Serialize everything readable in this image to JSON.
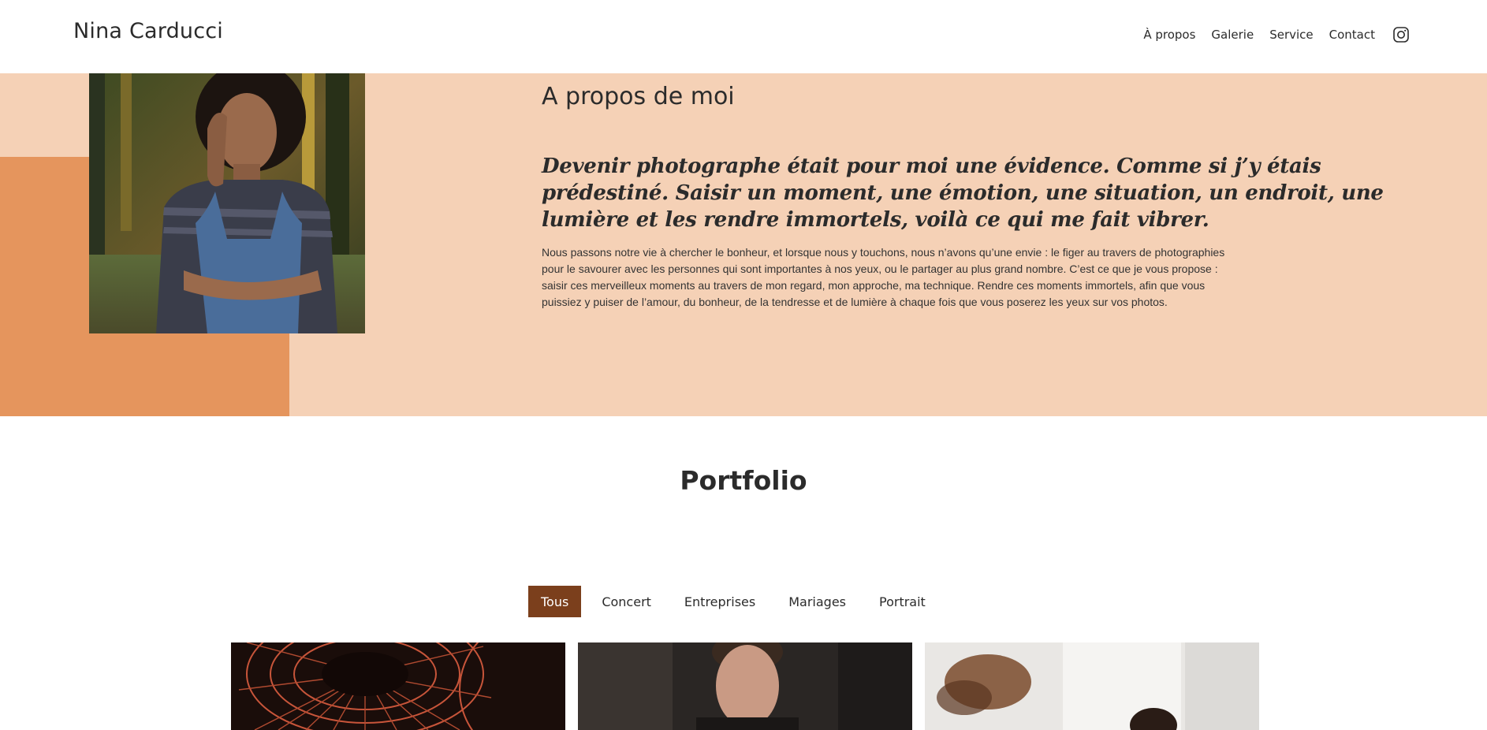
{
  "header": {
    "brand": "Nina Carducci",
    "nav": [
      "À propos",
      "Galerie",
      "Service",
      "Contact"
    ],
    "social_icon": "instagram-icon"
  },
  "about": {
    "title": "A propos de moi",
    "quote": "Devenir photographe était pour moi une évidence. Comme si j’y étais prédestiné. Saisir un moment, une émotion, une situation, un endroit, une lumière et les rendre immortels, voilà ce qui me fait vibrer.",
    "body": "Nous passons notre vie à chercher le bonheur, et lorsque nous y touchons, nous n’avons qu’une envie : le figer au travers de photographies pour le savourer avec les personnes qui sont importantes à nos yeux, ou le partager au plus grand nombre. C’est ce que je vous propose : saisir ces merveilleux moments au travers de mon regard, mon approche, ma technique. Rendre ces moments immortels, afin que vous puissiez y puiser de l’amour, du bonheur, de la tendresse et de lumière à chaque fois que vous poserez les yeux sur vos photos.",
    "colors": {
      "background": "#f5d1b6",
      "accent": "#e5955d"
    }
  },
  "portfolio": {
    "title": "Portfolio",
    "filters": [
      "Tous",
      "Concert",
      "Entreprises",
      "Mariages",
      "Portrait"
    ],
    "active_filter": "Tous",
    "active_color": "#7b3f1c"
  }
}
